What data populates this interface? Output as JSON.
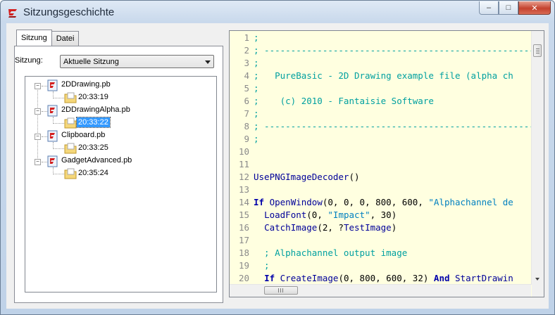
{
  "window": {
    "title": "Sitzungsgeschichte",
    "controls": {
      "minimize": "–",
      "maximize": "□",
      "close": "✕"
    }
  },
  "left_panel": {
    "tabs": [
      {
        "label": "Sitzung",
        "active": true
      },
      {
        "label": "Datei",
        "active": false
      }
    ],
    "session_label": "Sitzung:",
    "session_select": "Aktuelle Sitzung",
    "tree": [
      {
        "file": "2DDrawing.pb",
        "time": "20:33:19",
        "selected": false
      },
      {
        "file": "2DDrawingAlpha.pb",
        "time": "20:33:22",
        "selected": true
      },
      {
        "file": "Clipboard.pb",
        "time": "20:33:25",
        "selected": false
      },
      {
        "file": "GadgetAdvanced.pb",
        "time": "20:35:24",
        "selected": false
      }
    ]
  },
  "editor": {
    "lines": [
      {
        "n": "1",
        "text": ";"
      },
      {
        "n": "2",
        "text": "; ---------------------------------------------------------"
      },
      {
        "n": "3",
        "text": ";"
      },
      {
        "n": "4",
        "text": ";   PureBasic - 2D Drawing example file (alpha ch"
      },
      {
        "n": "5",
        "text": ";"
      },
      {
        "n": "6",
        "text": ";    (c) 2010 - Fantaisie Software"
      },
      {
        "n": "7",
        "text": ";"
      },
      {
        "n": "8",
        "text": "; ---------------------------------------------------------"
      },
      {
        "n": "9",
        "text": ";"
      },
      {
        "n": "10",
        "text": ""
      },
      {
        "n": "11",
        "text": ""
      },
      {
        "n": "12",
        "text": "UsePNGImageDecoder()"
      },
      {
        "n": "13",
        "text": ""
      },
      {
        "n": "14",
        "text": "If OpenWindow(0, 0, 0, 800, 600, \"Alphachannel de"
      },
      {
        "n": "15",
        "text": "  LoadFont(0, \"Impact\", 30)"
      },
      {
        "n": "16",
        "text": "  CatchImage(2, ?TestImage)"
      },
      {
        "n": "17",
        "text": ""
      },
      {
        "n": "18",
        "text": "  ; Alphachannel output image"
      },
      {
        "n": "19",
        "text": "  ;"
      },
      {
        "n": "20",
        "text": "  If CreateImage(0, 800, 600, 32) And StartDrawin"
      }
    ]
  },
  "colors": {
    "comment": "#00a0a0",
    "keyword": "#0000aa",
    "string": "#0080c0",
    "selection": "#3399ff",
    "editor_bg": "#ffffe0"
  }
}
